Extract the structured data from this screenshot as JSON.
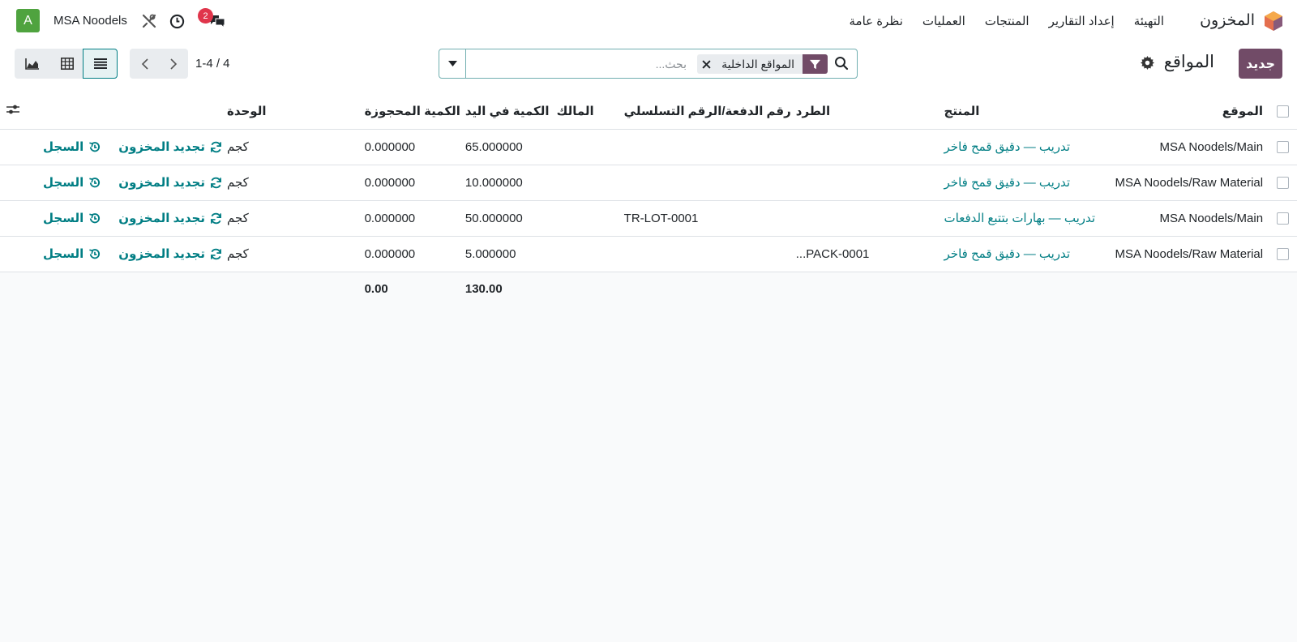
{
  "navbar": {
    "app_name": "المخزون",
    "menu": [
      "نظرة عامة",
      "العمليات",
      "المنتجات",
      "إعداد التقارير",
      "التهيئة"
    ],
    "company": "MSA Noodels",
    "avatar_letter": "A",
    "messages_count": "2",
    "icons": [
      "inventory-app-icon",
      "chat-icon",
      "clock-icon",
      "tools-icon"
    ]
  },
  "control": {
    "new_label": "جديد",
    "title": "المواقع",
    "search": {
      "facet_label": "المواقع الداخلية",
      "placeholder": "بحث..."
    },
    "pager": "1-4 / 4"
  },
  "colors": {
    "brand": "#714b67",
    "link": "#017e84",
    "avatar": "#4fa33f",
    "badge": "#e0354b"
  },
  "list": {
    "headers": {
      "location": "الموقع",
      "product": "المنتج",
      "package": "الطرد",
      "lot": "رقم الدفعة/الرقم التسلسلي",
      "owner": "المالك",
      "on_hand": "الكمية في اليد",
      "reserved": "الكمية المحجوزة",
      "uom": "الوحدة"
    },
    "history_label": "السجل",
    "replenish_label": "تجديد المخزون",
    "rows": [
      {
        "location": "MSA Noodels/Main",
        "product": "تدريب — دقيق قمح فاخر",
        "package": "",
        "lot": "",
        "owner": "",
        "on_hand": "65.000000",
        "reserved": "0.000000",
        "uom": "كجم"
      },
      {
        "location": "MSA Noodels/Raw Material",
        "product": "تدريب — دقيق قمح فاخر",
        "package": "",
        "lot": "",
        "owner": "",
        "on_hand": "10.000000",
        "reserved": "0.000000",
        "uom": "كجم"
      },
      {
        "location": "MSA Noodels/Main",
        "product": "تدريب — بهارات بتتبع الدفعات",
        "package": "",
        "lot": "TR-LOT-0001",
        "owner": "",
        "on_hand": "50.000000",
        "reserved": "0.000000",
        "uom": "كجم"
      },
      {
        "location": "MSA Noodels/Raw Material",
        "product": "تدريب — دقيق قمح فاخر",
        "package": "PACK-0001...",
        "lot": "",
        "owner": "",
        "on_hand": "5.000000",
        "reserved": "0.000000",
        "uom": "كجم"
      }
    ],
    "totals": {
      "on_hand": "130.00",
      "reserved": "0.00"
    }
  }
}
